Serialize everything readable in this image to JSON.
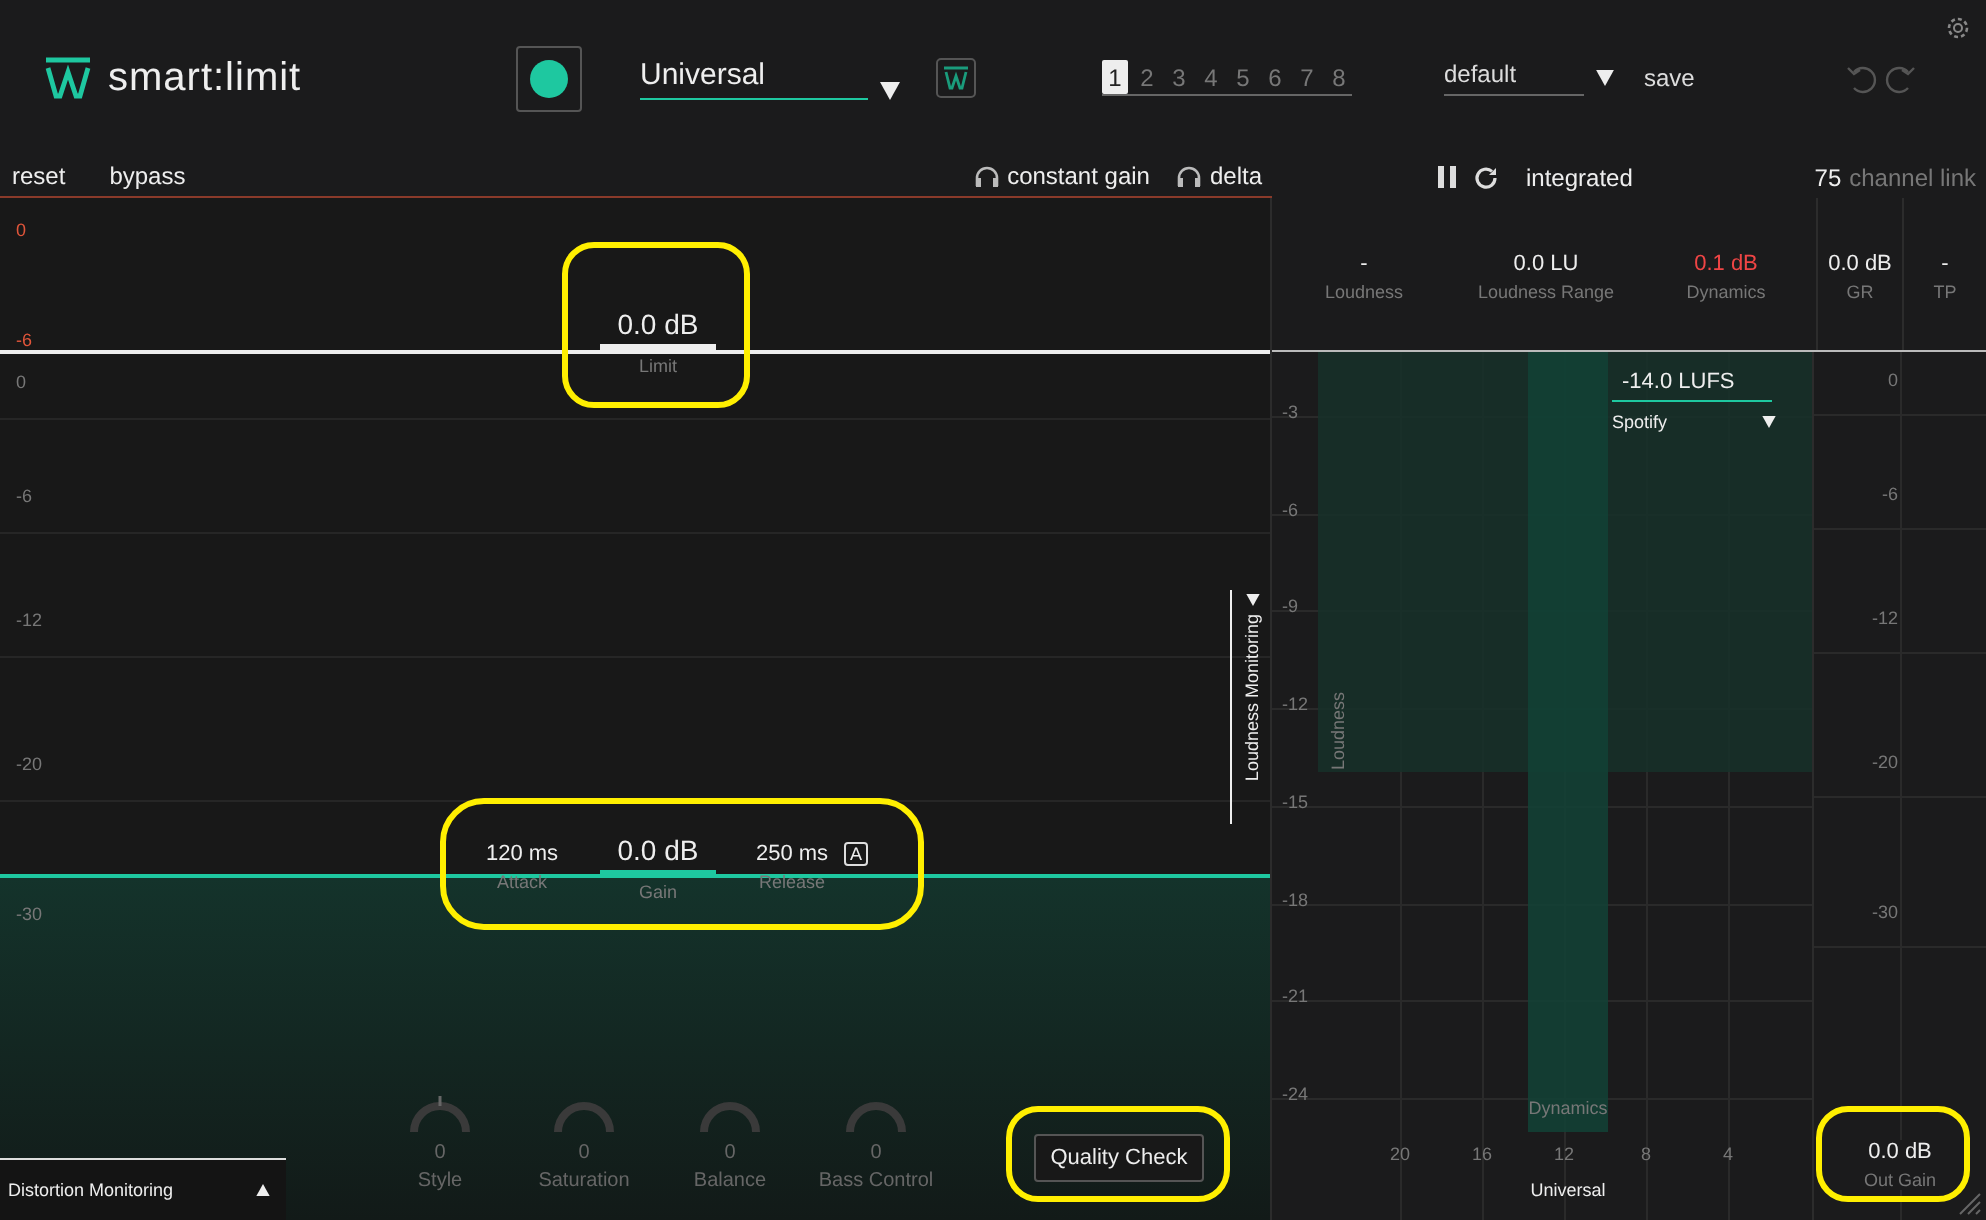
{
  "header": {
    "logo": "smart:limit",
    "record_active": true,
    "preset": "Universal",
    "snapshots": [
      {
        "label": "1",
        "selected": true
      },
      {
        "label": "2",
        "selected": false
      },
      {
        "label": "3",
        "selected": false
      },
      {
        "label": "4",
        "selected": false
      },
      {
        "label": "5",
        "selected": false
      },
      {
        "label": "6",
        "selected": false
      },
      {
        "label": "7",
        "selected": false
      },
      {
        "label": "8",
        "selected": false
      }
    ],
    "profile": "default",
    "save": "save"
  },
  "toolbar": {
    "reset": "reset",
    "bypass": "bypass",
    "listen": [
      {
        "label": "constant gain"
      },
      {
        "label": "delta"
      }
    ],
    "mode": "integrated",
    "channel_link_value": "75",
    "channel_link_label": "channel link"
  },
  "limiter": {
    "input_scale": [
      "0",
      "-6"
    ],
    "scale": [
      "0",
      "-6",
      "-12",
      "-20",
      "-30"
    ],
    "limit": {
      "value": "0.0 dB",
      "label": "Limit",
      "highlight": true
    },
    "gain_panel": {
      "highlight": true,
      "auto_badge": "A",
      "controls": [
        {
          "value": "120 ms",
          "label": "Attack"
        },
        {
          "value": "0.0 dB",
          "label": "Gain"
        },
        {
          "value": "250 ms",
          "label": "Release"
        }
      ]
    },
    "knobs": [
      {
        "value": "0",
        "label": "Style"
      },
      {
        "value": "0",
        "label": "Saturation"
      },
      {
        "value": "0",
        "label": "Balance"
      },
      {
        "value": "0",
        "label": "Bass Control"
      }
    ],
    "loudness_monitoring": "Loudness Monitoring",
    "distortion_monitoring": "Distortion Monitoring",
    "quality_check": {
      "label": "Quality Check",
      "highlight": true
    }
  },
  "metrics": [
    {
      "value": "-",
      "label": "Loudness",
      "warning": false
    },
    {
      "value": "0.0 LU",
      "label": "Loudness Range",
      "warning": false
    },
    {
      "value": "0.1 dB",
      "label": "Dynamics",
      "warning": true
    },
    {
      "value": "0.0 dB",
      "label": "GR",
      "warning": false
    },
    {
      "value": "-",
      "label": "TP",
      "warning": false
    }
  ],
  "loudness_chart": {
    "y_labels": [
      "-3",
      "-6",
      "-9",
      "-12",
      "-15",
      "-18",
      "-21",
      "-24"
    ],
    "x_labels": [
      "20",
      "16",
      "12",
      "8",
      "4"
    ],
    "x_title": "Universal",
    "loudness_label": "Loudness",
    "dynamics_label": "Dynamics",
    "target": "-14.0 LUFS",
    "platform": "Spotify"
  },
  "out_meter": {
    "scale": [
      "0",
      "-6",
      "-12",
      "-20",
      "-30"
    ],
    "value": "0.0 dB",
    "label": "Out Gain",
    "highlight": true
  }
}
